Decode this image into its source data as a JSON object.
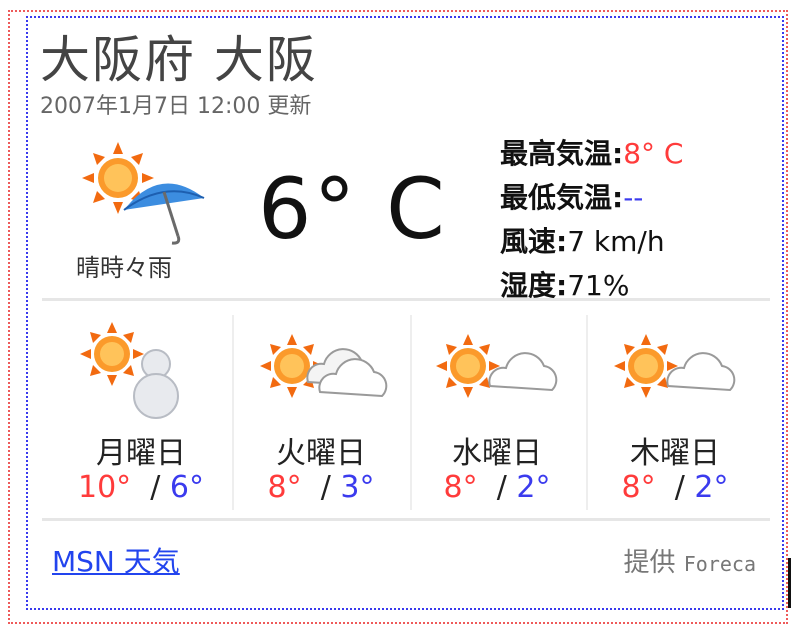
{
  "location": "大阪府 大阪",
  "updated": "2007年1月7日  12:00 更新",
  "current": {
    "condition": "晴時々雨",
    "icon": "sun-with-umbrella-icon",
    "temperature": "6°  C",
    "stats": [
      {
        "label": "最高気温:",
        "value": "8°  C",
        "color": "#ff3b3b"
      },
      {
        "label": "最低気温:",
        "value": "--",
        "color": "#3b3bee"
      },
      {
        "label": "風速:",
        "value": "7 km/h",
        "color": "#222222"
      },
      {
        "label": "湿度:",
        "value": "71%",
        "color": "#222222"
      }
    ]
  },
  "forecast": [
    {
      "day": "月曜日",
      "high": "10°",
      "low": "6°",
      "icon": "sun-snowman-icon"
    },
    {
      "day": "火曜日",
      "high": "8°",
      "low": "3°",
      "icon": "sun-cloud-icon"
    },
    {
      "day": "水曜日",
      "high": "8°",
      "low": "2°",
      "icon": "sun-cloud-icon"
    },
    {
      "day": "木曜日",
      "high": "8°",
      "low": "2°",
      "icon": "sun-cloud-icon"
    }
  ],
  "footer": {
    "link": "MSN 天気",
    "provider_label": "提供",
    "provider_name": "Foreca"
  },
  "colors": {
    "high": "#ff3b3b",
    "low": "#3b3bee",
    "link": "#2244ee"
  }
}
